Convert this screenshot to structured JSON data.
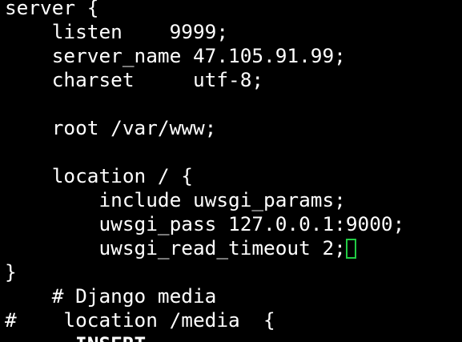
{
  "editor": {
    "lines": [
      "server {",
      "    listen    9999;",
      "    server_name 47.105.91.99;",
      "    charset     utf-8;",
      "",
      "    root /var/www;",
      "",
      "    location / {",
      "        include uwsgi_params;",
      "        uwsgi_pass 127.0.0.1:9000;",
      "        uwsgi_read_timeout 2;",
      "}",
      "    # Django media",
      "#    location /media  {"
    ],
    "status_mode": "-- INSERT --",
    "colors": {
      "background": "#000000",
      "text": "#ffffff",
      "cursor": "#22cc44"
    }
  }
}
